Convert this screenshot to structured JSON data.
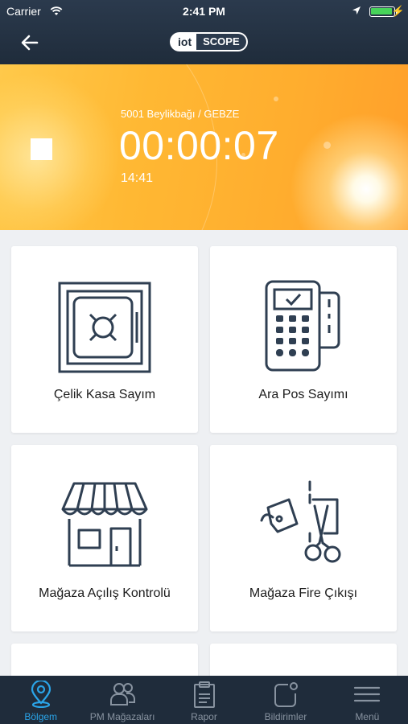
{
  "status_bar": {
    "carrier": "Carrier",
    "time": "2:41 PM"
  },
  "nav": {
    "back_icon": "arrow-left-icon",
    "logo_left": "iot",
    "logo_right": "SCOPE"
  },
  "banner": {
    "store": "5001 Beylikbağı  /  GEBZE",
    "timer": "00:00:07",
    "clock": "14:41"
  },
  "tiles": [
    {
      "label": "Çelik Kasa Sayım",
      "icon": "safe-icon"
    },
    {
      "label": "Ara Pos Sayımı",
      "icon": "pos-terminal-icon"
    },
    {
      "label": "Mağaza Açılış Kontrolü",
      "icon": "storefront-icon"
    },
    {
      "label": "Mağaza Fire Çıkışı",
      "icon": "scissors-tag-icon"
    }
  ],
  "tabbar": {
    "items": [
      {
        "label": "Bölgem",
        "icon": "location-pin-icon",
        "active": true
      },
      {
        "label": "PM Mağazaları",
        "icon": "users-icon",
        "active": false
      },
      {
        "label": "Rapor",
        "icon": "clipboard-icon",
        "active": false
      },
      {
        "label": "Bildirimler",
        "icon": "notification-icon",
        "active": false
      },
      {
        "label": "Menü",
        "icon": "hamburger-icon",
        "active": false
      }
    ]
  },
  "colors": {
    "header": "#1f2c3b",
    "accent": "#2aa4e8",
    "icon_stroke": "#2f3f52"
  }
}
